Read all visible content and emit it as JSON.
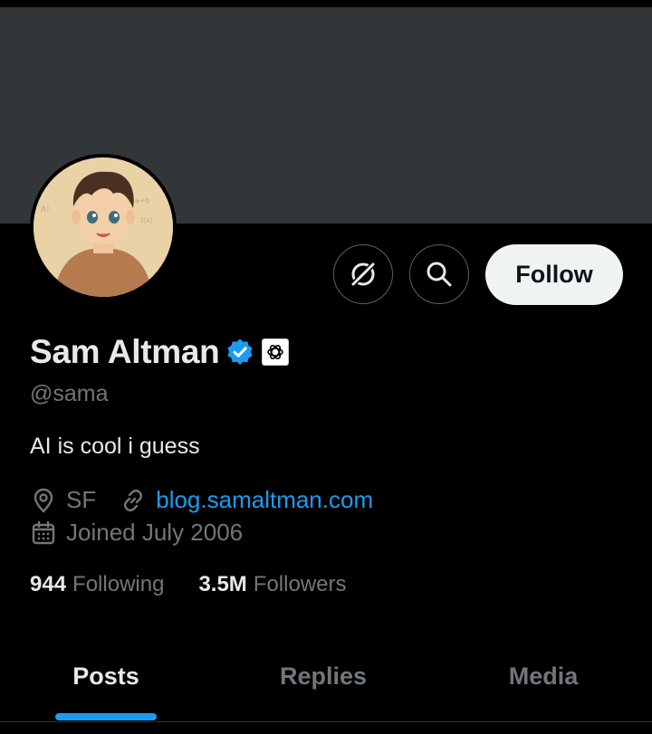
{
  "profile": {
    "display_name": "Sam Altman",
    "handle": "@sama",
    "bio": "AI is cool i guess",
    "location": "SF",
    "website": "blog.samaltman.com",
    "joined": "Joined July 2006",
    "following_count": "944",
    "following_label": "Following",
    "followers_count": "3.5M",
    "followers_label": "Followers"
  },
  "actions": {
    "follow_label": "Follow"
  },
  "tabs": [
    {
      "label": "Posts",
      "active": true
    },
    {
      "label": "Replies",
      "active": false
    },
    {
      "label": "Media",
      "active": false
    }
  ],
  "colors": {
    "background": "#000000",
    "banner": "#333639",
    "accent": "#1d9bf0",
    "muted_text": "#71767b",
    "primary_text": "#e7e9ea"
  },
  "icons": [
    "grok-icon",
    "search-icon",
    "verified-badge-icon",
    "openai-affiliate-icon",
    "location-pin-icon",
    "link-icon",
    "calendar-icon"
  ]
}
